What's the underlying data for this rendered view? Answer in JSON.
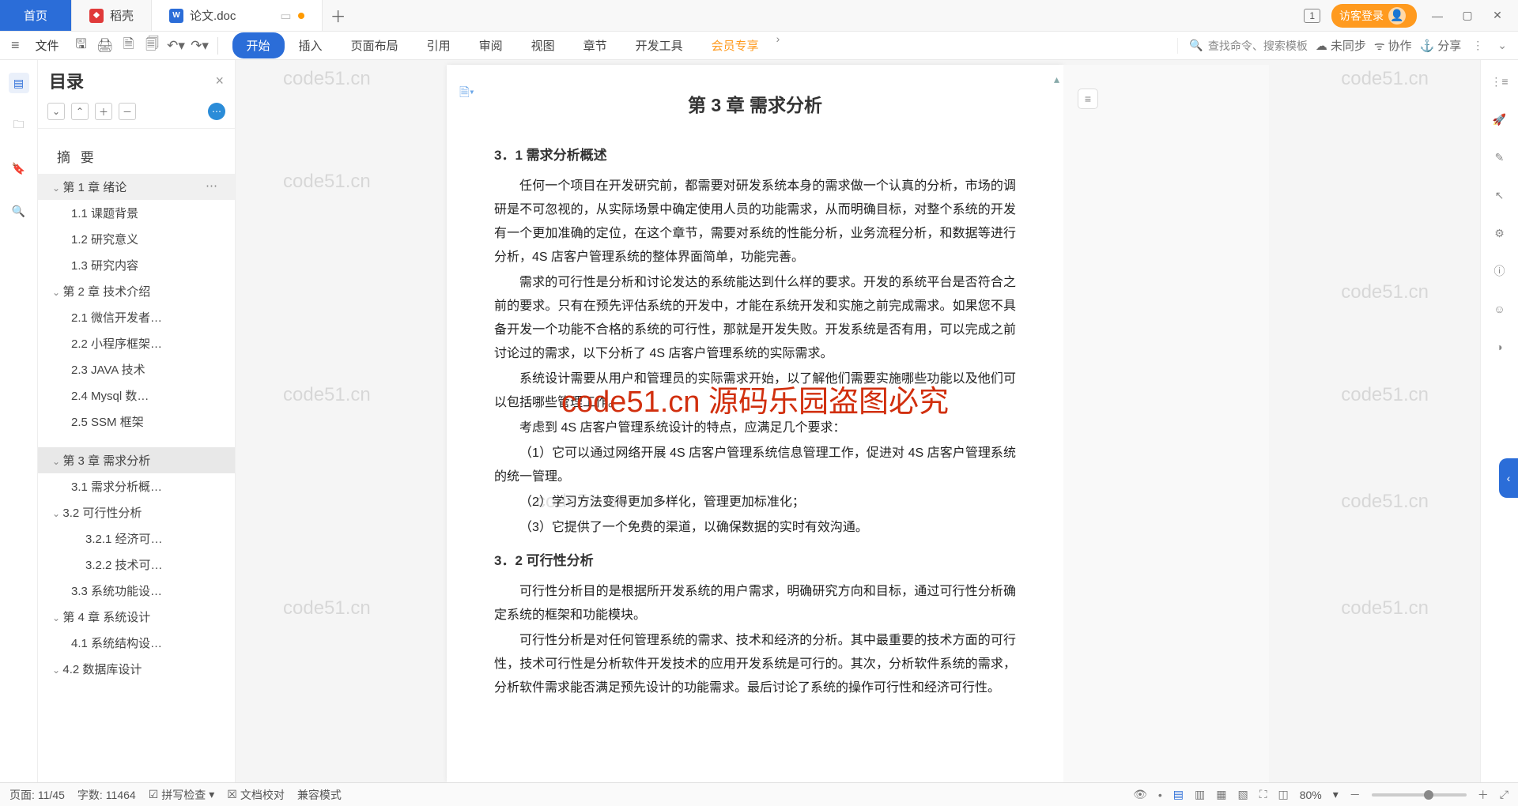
{
  "tabs": {
    "home": "首页",
    "docshell": "稻壳",
    "file": "论文.doc"
  },
  "tabs_right": {
    "badge": "1",
    "login": "访客登录"
  },
  "ribbon": {
    "file": "文件",
    "tabs": [
      "开始",
      "插入",
      "页面布局",
      "引用",
      "审阅",
      "视图",
      "章节",
      "开发工具",
      "会员专享"
    ],
    "search": "查找命令、搜索模板",
    "sync": "未同步",
    "coop": "协作",
    "share": "分享"
  },
  "toc": {
    "title": "目录",
    "abstract": "摘 要",
    "items": [
      {
        "t": "第 1 章  绪论",
        "lv": 1
      },
      {
        "t": "1.1 课题背景",
        "lv": 2
      },
      {
        "t": "1.2 研究意义",
        "lv": 2
      },
      {
        "t": "1.3 研究内容",
        "lv": 2
      },
      {
        "t": "第 2 章  技术介绍",
        "lv": 1
      },
      {
        "t": "2.1 微信开发者…",
        "lv": 2
      },
      {
        "t": "2.2 小程序框架…",
        "lv": 2
      },
      {
        "t": "2.3 JAVA 技术",
        "lv": 2
      },
      {
        "t": "2.4   Mysql 数…",
        "lv": 2
      },
      {
        "t": "2.5 SSM 框架",
        "lv": 2
      },
      {
        "t": "第 3 章  需求分析",
        "lv": 1,
        "sel": true
      },
      {
        "t": "3.1 需求分析概…",
        "lv": 2
      },
      {
        "t": "3.2 可行性分析",
        "lv": 2,
        "exp": true
      },
      {
        "t": "3.2.1 经济可…",
        "lv": 3
      },
      {
        "t": "3.2.2 技术可…",
        "lv": 3
      },
      {
        "t": "3.3 系统功能设…",
        "lv": 2
      },
      {
        "t": "第 4 章  系统设计",
        "lv": 1
      },
      {
        "t": "4.1 系统结构设…",
        "lv": 2
      },
      {
        "t": "4.2 数据库设计",
        "lv": 2,
        "exp": true
      }
    ]
  },
  "doc": {
    "title": "第 3 章  需求分析",
    "h31": "3．1 需求分析概述",
    "p1": "任何一个项目在开发研究前，都需要对研发系统本身的需求做一个认真的分析，市场的调研是不可忽视的，从实际场景中确定使用人员的功能需求，从而明确目标，对整个系统的开发有一个更加准确的定位，在这个章节，需要对系统的性能分析，业务流程分析，和数据等进行分析，4S 店客户管理系统的整体界面简单，功能完善。",
    "p2": "需求的可行性是分析和讨论发达的系统能达到什么样的要求。开发的系统平台是否符合之前的要求。只有在预先评估系统的开发中，才能在系统开发和实施之前完成需求。如果您不具备开发一个功能不合格的系统的可行性，那就是开发失败。开发系统是否有用，可以完成之前讨论过的需求，以下分析了 4S 店客户管理系统的实际需求。",
    "p3": "系统设计需要从用户和管理员的实际需求开始，以了解他们需要实施哪些功能以及他们可以包括哪些管理工作。",
    "p4": "考虑到 4S 店客户管理系统设计的特点，应满足几个要求：",
    "p5": "（1）它可以通过网络开展 4S 店客户管理系统信息管理工作，促进对 4S 店客户管理系统的统一管理。",
    "p6": "（2）学习方法变得更加多样化，管理更加标准化；",
    "p7": "（3）它提供了一个免费的渠道，以确保数据的实时有效沟通。",
    "h32": "3．2 可行性分析",
    "p8": "可行性分析目的是根据所开发系统的用户需求，明确研究方向和目标，通过可行性分析确定系统的框架和功能模块。",
    "p9": "可行性分析是对任何管理系统的需求、技术和经济的分析。其中最重要的技术方面的可行性，技术可行性是分析软件开发技术的应用开发系统是可行的。其次，分析软件系统的需求，分析软件需求能否满足预先设计的功能需求。最后讨论了系统的操作可行性和经济可行性。"
  },
  "wm": {
    "red": "code51.cn 源码乐园盗图必究",
    "gray": "code51.cn"
  },
  "status": {
    "page_lbl": "页面:",
    "page": "11/45",
    "words_lbl": "字数:",
    "words": "11464",
    "spell": "拼写检查",
    "proof": "文档校对",
    "compat": "兼容模式",
    "zoom": "80%"
  }
}
